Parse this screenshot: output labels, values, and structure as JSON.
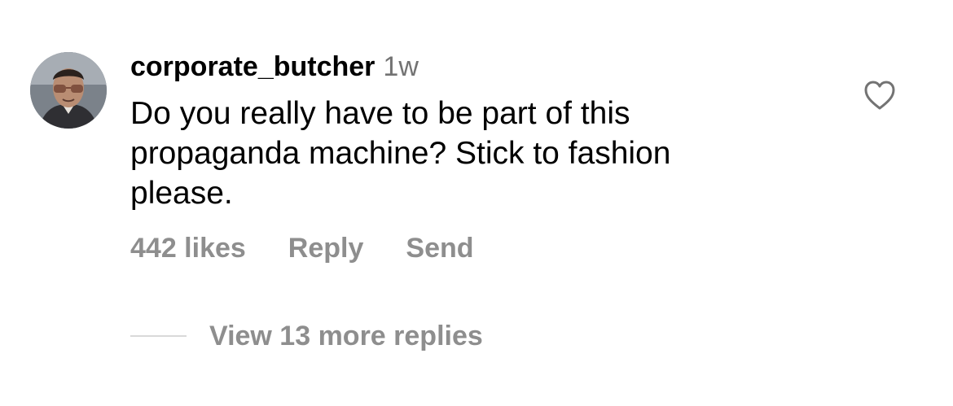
{
  "comment": {
    "username": "corporate_butcher",
    "timestamp": "1w",
    "text": "Do you really have to be part of this propaganda machine? Stick to fashion please.",
    "likes_label": "442 likes",
    "reply_label": "Reply",
    "send_label": "Send",
    "view_replies_label": "View 13 more replies"
  },
  "icons": {
    "avatar": "user-avatar",
    "like": "heart-outline-icon"
  },
  "colors": {
    "primary_text": "#000000",
    "secondary_text": "#8e8e8e",
    "timestamp_text": "#737373",
    "divider": "#d9d9d9"
  }
}
